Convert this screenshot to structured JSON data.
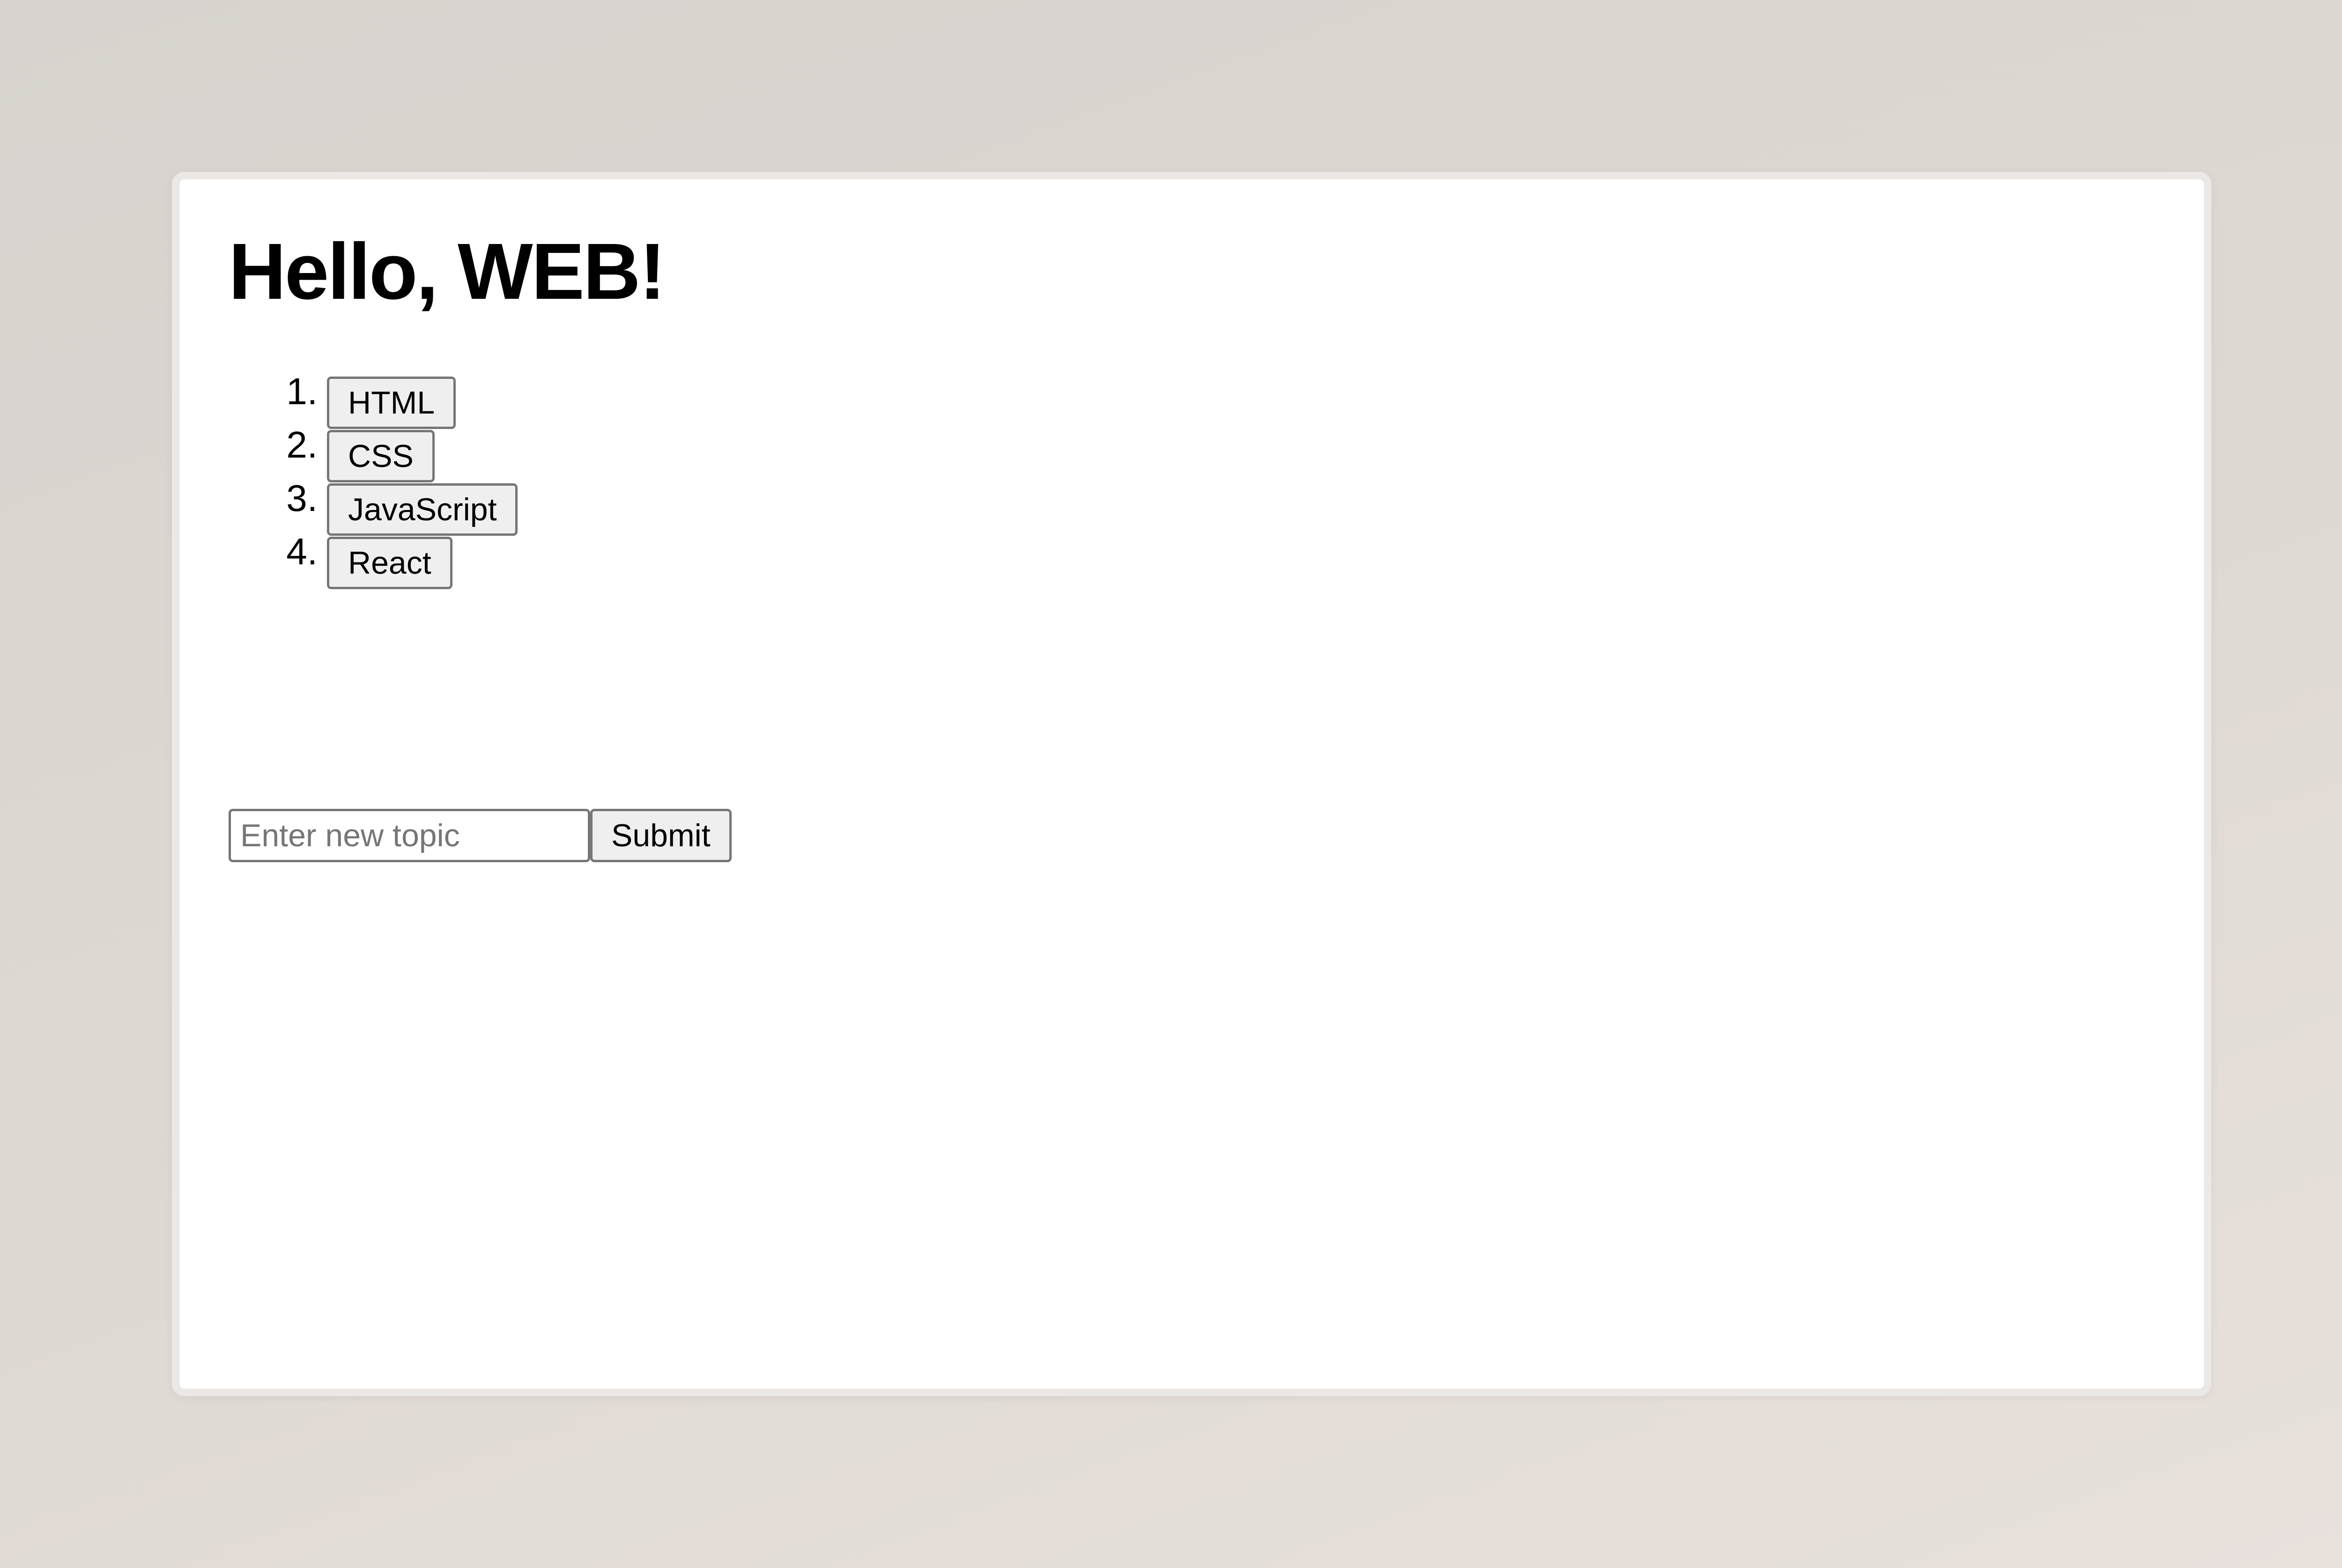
{
  "heading": "Hello, WEB!",
  "topics": [
    {
      "number": "1.",
      "label": "HTML"
    },
    {
      "number": "2.",
      "label": "CSS"
    },
    {
      "number": "3.",
      "label": "JavaScript"
    },
    {
      "number": "4.",
      "label": "React"
    }
  ],
  "form": {
    "placeholder": "Enter new topic",
    "value": "",
    "submit_label": "Submit"
  },
  "colors": {
    "page_background": "#ffffff",
    "button_background": "#efefef",
    "button_border": "#767676",
    "text": "#000000"
  }
}
